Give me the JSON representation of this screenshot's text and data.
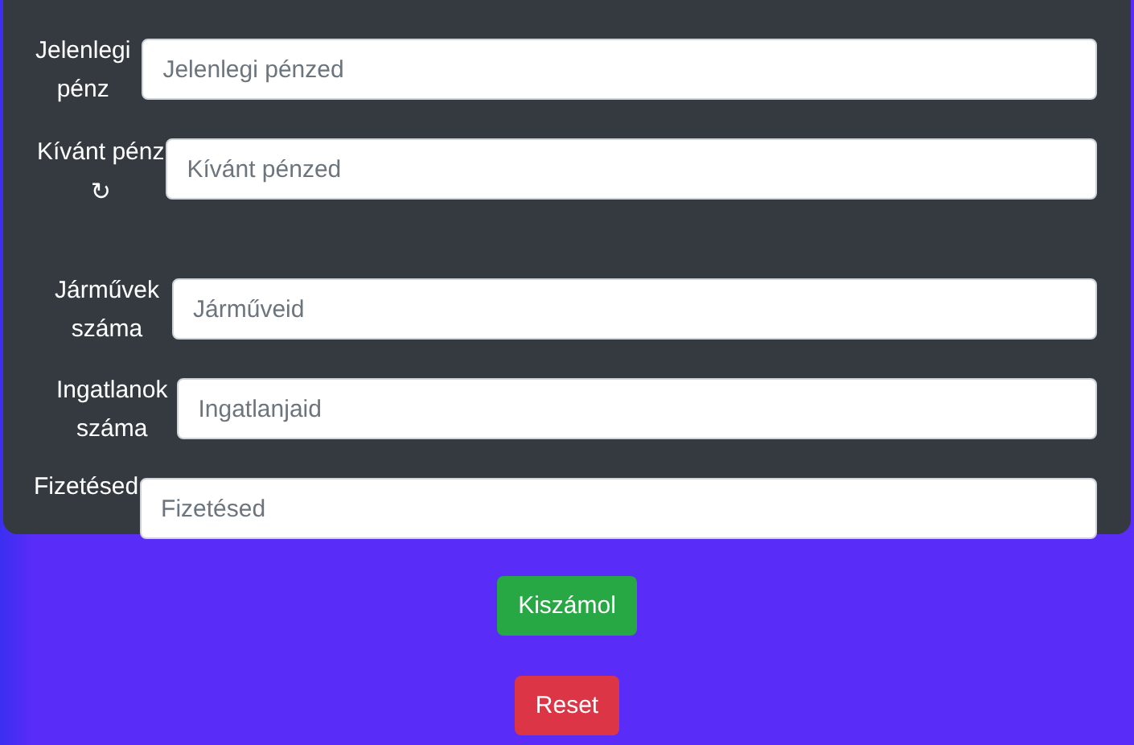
{
  "money_fields": [
    {
      "label": "Jelenlegi pénz",
      "placeholder": "Jelenlegi pénzed"
    },
    {
      "label": "Kívánt pénz",
      "icon": "↻",
      "placeholder": "Kívánt pénzed"
    }
  ],
  "asset_fields": [
    {
      "label": "Járművek száma",
      "placeholder": "Járműveid"
    },
    {
      "label": "Ingatlanok száma",
      "placeholder": "Ingatlanjaid"
    },
    {
      "label": "Fizetésed",
      "placeholder": "Fizetésed"
    }
  ],
  "buttons": [
    {
      "label": "Kiszámol",
      "kind": "primary"
    },
    {
      "label": "Reset",
      "kind": "danger"
    }
  ]
}
